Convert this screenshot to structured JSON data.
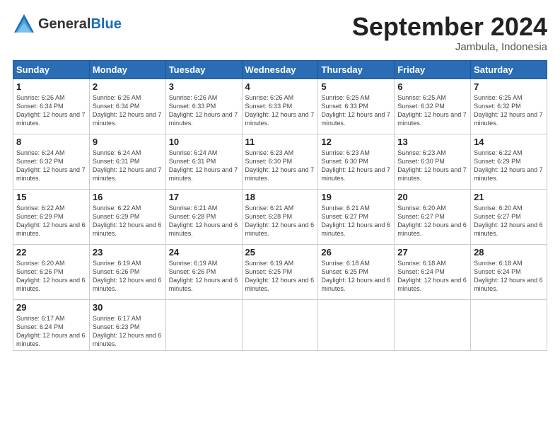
{
  "header": {
    "logo_general": "General",
    "logo_blue": "Blue",
    "month_title": "September 2024",
    "location": "Jambula, Indonesia"
  },
  "weekdays": [
    "Sunday",
    "Monday",
    "Tuesday",
    "Wednesday",
    "Thursday",
    "Friday",
    "Saturday"
  ],
  "weeks": [
    [
      {
        "day": "1",
        "sunrise": "6:26 AM",
        "sunset": "6:34 PM",
        "daylight": "12 hours and 7 minutes."
      },
      {
        "day": "2",
        "sunrise": "6:26 AM",
        "sunset": "6:34 PM",
        "daylight": "12 hours and 7 minutes."
      },
      {
        "day": "3",
        "sunrise": "6:26 AM",
        "sunset": "6:33 PM",
        "daylight": "12 hours and 7 minutes."
      },
      {
        "day": "4",
        "sunrise": "6:26 AM",
        "sunset": "6:33 PM",
        "daylight": "12 hours and 7 minutes."
      },
      {
        "day": "5",
        "sunrise": "6:25 AM",
        "sunset": "6:33 PM",
        "daylight": "12 hours and 7 minutes."
      },
      {
        "day": "6",
        "sunrise": "6:25 AM",
        "sunset": "6:32 PM",
        "daylight": "12 hours and 7 minutes."
      },
      {
        "day": "7",
        "sunrise": "6:25 AM",
        "sunset": "6:32 PM",
        "daylight": "12 hours and 7 minutes."
      }
    ],
    [
      {
        "day": "8",
        "sunrise": "6:24 AM",
        "sunset": "6:32 PM",
        "daylight": "12 hours and 7 minutes."
      },
      {
        "day": "9",
        "sunrise": "6:24 AM",
        "sunset": "6:31 PM",
        "daylight": "12 hours and 7 minutes."
      },
      {
        "day": "10",
        "sunrise": "6:24 AM",
        "sunset": "6:31 PM",
        "daylight": "12 hours and 7 minutes."
      },
      {
        "day": "11",
        "sunrise": "6:23 AM",
        "sunset": "6:30 PM",
        "daylight": "12 hours and 7 minutes."
      },
      {
        "day": "12",
        "sunrise": "6:23 AM",
        "sunset": "6:30 PM",
        "daylight": "12 hours and 7 minutes."
      },
      {
        "day": "13",
        "sunrise": "6:23 AM",
        "sunset": "6:30 PM",
        "daylight": "12 hours and 7 minutes."
      },
      {
        "day": "14",
        "sunrise": "6:22 AM",
        "sunset": "6:29 PM",
        "daylight": "12 hours and 7 minutes."
      }
    ],
    [
      {
        "day": "15",
        "sunrise": "6:22 AM",
        "sunset": "6:29 PM",
        "daylight": "12 hours and 6 minutes."
      },
      {
        "day": "16",
        "sunrise": "6:22 AM",
        "sunset": "6:29 PM",
        "daylight": "12 hours and 6 minutes."
      },
      {
        "day": "17",
        "sunrise": "6:21 AM",
        "sunset": "6:28 PM",
        "daylight": "12 hours and 6 minutes."
      },
      {
        "day": "18",
        "sunrise": "6:21 AM",
        "sunset": "6:28 PM",
        "daylight": "12 hours and 6 minutes."
      },
      {
        "day": "19",
        "sunrise": "6:21 AM",
        "sunset": "6:27 PM",
        "daylight": "12 hours and 6 minutes."
      },
      {
        "day": "20",
        "sunrise": "6:20 AM",
        "sunset": "6:27 PM",
        "daylight": "12 hours and 6 minutes."
      },
      {
        "day": "21",
        "sunrise": "6:20 AM",
        "sunset": "6:27 PM",
        "daylight": "12 hours and 6 minutes."
      }
    ],
    [
      {
        "day": "22",
        "sunrise": "6:20 AM",
        "sunset": "6:26 PM",
        "daylight": "12 hours and 6 minutes."
      },
      {
        "day": "23",
        "sunrise": "6:19 AM",
        "sunset": "6:26 PM",
        "daylight": "12 hours and 6 minutes."
      },
      {
        "day": "24",
        "sunrise": "6:19 AM",
        "sunset": "6:26 PM",
        "daylight": "12 hours and 6 minutes."
      },
      {
        "day": "25",
        "sunrise": "6:19 AM",
        "sunset": "6:25 PM",
        "daylight": "12 hours and 6 minutes."
      },
      {
        "day": "26",
        "sunrise": "6:18 AM",
        "sunset": "6:25 PM",
        "daylight": "12 hours and 6 minutes."
      },
      {
        "day": "27",
        "sunrise": "6:18 AM",
        "sunset": "6:24 PM",
        "daylight": "12 hours and 6 minutes."
      },
      {
        "day": "28",
        "sunrise": "6:18 AM",
        "sunset": "6:24 PM",
        "daylight": "12 hours and 6 minutes."
      }
    ],
    [
      {
        "day": "29",
        "sunrise": "6:17 AM",
        "sunset": "6:24 PM",
        "daylight": "12 hours and 6 minutes."
      },
      {
        "day": "30",
        "sunrise": "6:17 AM",
        "sunset": "6:23 PM",
        "daylight": "12 hours and 6 minutes."
      },
      {
        "day": "",
        "sunrise": "",
        "sunset": "",
        "daylight": ""
      },
      {
        "day": "",
        "sunrise": "",
        "sunset": "",
        "daylight": ""
      },
      {
        "day": "",
        "sunrise": "",
        "sunset": "",
        "daylight": ""
      },
      {
        "day": "",
        "sunrise": "",
        "sunset": "",
        "daylight": ""
      },
      {
        "day": "",
        "sunrise": "",
        "sunset": "",
        "daylight": ""
      }
    ]
  ]
}
